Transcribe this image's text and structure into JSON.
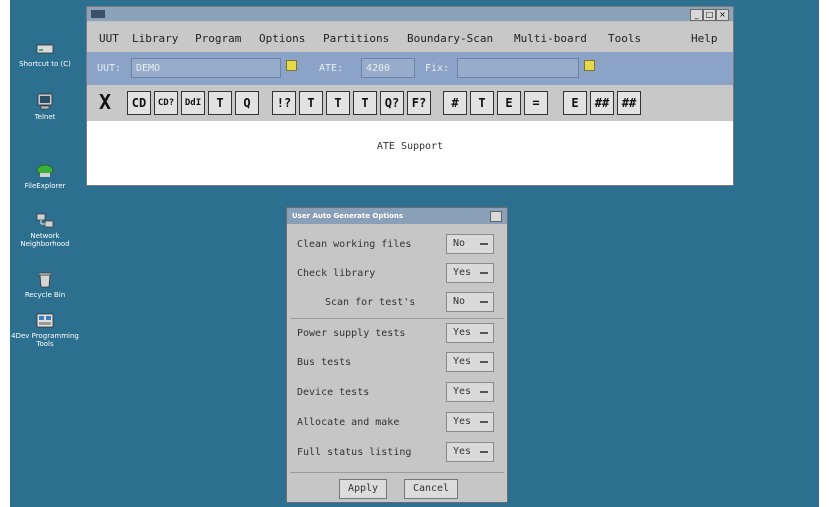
{
  "desktop": {
    "icons": [
      {
        "label": "Shortcut to (C)",
        "icon": "drive-icon"
      },
      {
        "label": "Telnet",
        "icon": "terminal-icon"
      },
      {
        "label": "FileExplorer",
        "icon": "folder-icon"
      },
      {
        "label": "Network Neighborhood",
        "icon": "network-icon"
      },
      {
        "label": "Recycle Bin",
        "icon": "recycle-bin-icon"
      },
      {
        "label": "4Dev Programming Tools",
        "icon": "programming-tools-icon"
      }
    ]
  },
  "main_window": {
    "title": "",
    "controls": {
      "minimize": "_",
      "maximize": "□",
      "close": "×"
    },
    "menu": [
      "UUT",
      "Library",
      "Program",
      "Options",
      "Partitions",
      "Boundary-Scan",
      "Multi-board",
      "Tools",
      "Help"
    ],
    "fields": {
      "uut_label": "UUT:",
      "uut_value": "DEMO",
      "ate_label": "ATE:",
      "ate_value": "4200",
      "fix_label": "Fix:",
      "fix_value": ""
    },
    "toolbar_buttons": [
      {
        "text": "X",
        "icon": "close-x-icon"
      },
      {
        "text": "CD",
        "icon": "cd-icon"
      },
      {
        "text": "CD?",
        "icon": "cd-query-icon"
      },
      {
        "text": "DdI",
        "icon": "device-icon"
      },
      {
        "text": "T",
        "icon": "search-test-icon"
      },
      {
        "text": "Q",
        "icon": "magnify-icon"
      },
      {
        "text": "!?",
        "icon": "test-status-icon"
      },
      {
        "text": "T",
        "icon": "probe-icon"
      },
      {
        "text": "T",
        "icon": "test-pin-icon"
      },
      {
        "text": "T",
        "icon": "test-clip-icon"
      },
      {
        "text": "Q?",
        "icon": "query-icon"
      },
      {
        "text": "F?",
        "icon": "fault-query-icon"
      },
      {
        "text": "#",
        "icon": "board-icon"
      },
      {
        "text": "T",
        "icon": "tester-icon"
      },
      {
        "text": "E",
        "icon": "edit-icon"
      },
      {
        "text": "=",
        "icon": "fixture-icon"
      },
      {
        "text": "E",
        "icon": "report-icon"
      },
      {
        "text": "##",
        "icon": "grid-icon"
      },
      {
        "text": "##",
        "icon": "matrix-icon"
      }
    ],
    "status": "ATE Support"
  },
  "dialog": {
    "title": "User Auto Generate Options",
    "options": [
      {
        "label": "Clean working files",
        "value": "No",
        "indent": false
      },
      {
        "label": "Check library",
        "value": "Yes",
        "indent": false
      },
      {
        "label": "Scan for test's",
        "value": "No",
        "indent": true
      },
      {
        "label": "Power supply tests",
        "value": "Yes",
        "indent": false
      },
      {
        "label": "Bus tests",
        "value": "Yes",
        "indent": false
      },
      {
        "label": "Device tests",
        "value": "Yes",
        "indent": false
      },
      {
        "label": "Allocate and make",
        "value": "Yes",
        "indent": false
      },
      {
        "label": "Full status listing",
        "value": "Yes",
        "indent": false
      }
    ],
    "apply_label": "Apply",
    "cancel_label": "Cancel"
  },
  "colors": {
    "desktop": "#2d6f8f",
    "field_bar": "#8aa3c6",
    "dropdown_accent": "#e6d94a"
  }
}
